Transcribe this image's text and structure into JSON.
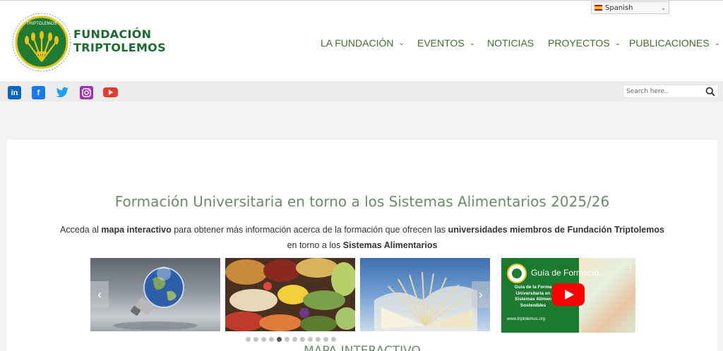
{
  "header": {
    "logo": {
      "brand_line1": "FUNDACIÓN",
      "brand_line2": "TRIPTOLEMOS",
      "ring_text": "FUNDACIÓ FUNDACIÓN",
      "seal_text": "TRIPTOLEMOS"
    },
    "language": {
      "selected": "Spanish"
    },
    "nav": [
      {
        "label": "LA FUNDACIÓN",
        "has_dropdown": true
      },
      {
        "label": "EVENTOS",
        "has_dropdown": true
      },
      {
        "label": "NOTICIAS",
        "has_dropdown": false
      },
      {
        "label": "PROYECTOS",
        "has_dropdown": true
      },
      {
        "label": "PUBLICACIONES",
        "has_dropdown": true
      }
    ]
  },
  "social": {
    "icons": [
      "linkedin-icon",
      "facebook-icon",
      "twitter-icon",
      "instagram-icon",
      "youtube-icon"
    ],
    "colors": {
      "linkedin": "#0a66c2",
      "facebook": "#1877f2",
      "twitter": "#1da1f2",
      "instagram": "#a033b5",
      "youtube": "#e33b2e"
    }
  },
  "search": {
    "placeholder": "Search here.."
  },
  "main": {
    "title": "Formación Universitaria en torno a los Sistemas Alimentarios 2025/26",
    "intro": {
      "p1": "Acceda al ",
      "b1": "mapa interactivo",
      "p2": " para obtener más información acerca de la formación que ofrecen las ",
      "b2": "universidades miembros de Fundación Triptolemos",
      "p3": "en torno a los ",
      "b3": "Sistemas Alimentarios"
    },
    "next_heading": "MAPA INTERACTIVO",
    "carousel": {
      "dot_count": 12,
      "active_index": 4
    },
    "video": {
      "title": "Guía de Formació...",
      "desc_lines": [
        "Guía de la Forma",
        "Universitaria en",
        "Sistemas Alimen",
        "Sostenibles"
      ],
      "url": "www.triptolemos.org"
    }
  },
  "colors": {
    "brand_green": "#1a6b2c",
    "nav_green": "#3c6f2a",
    "title_green": "#6b8b69"
  }
}
